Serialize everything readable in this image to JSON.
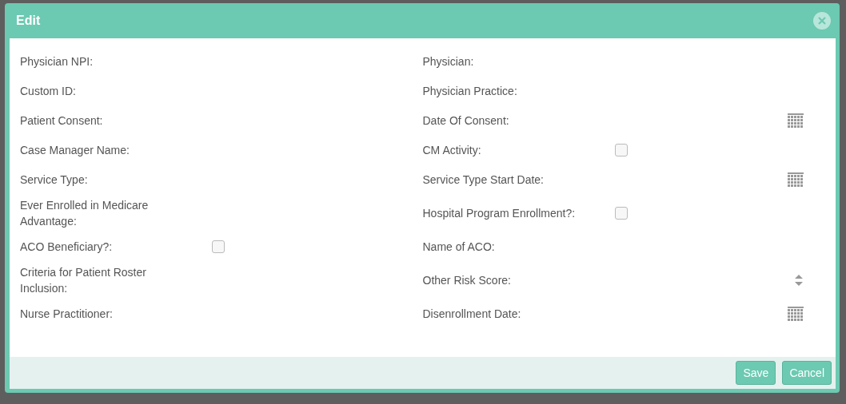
{
  "dialog": {
    "title": "Edit"
  },
  "rows": [
    {
      "left": {
        "label": "Physician NPI:",
        "kind": "text"
      },
      "right": {
        "label": "Physician:",
        "kind": "text"
      }
    },
    {
      "left": {
        "label": "Custom ID:",
        "kind": "text"
      },
      "right": {
        "label": "Physician Practice:",
        "kind": "text"
      }
    },
    {
      "left": {
        "label": "Patient Consent:",
        "kind": "text"
      },
      "right": {
        "label": "Date Of Consent:",
        "kind": "date"
      }
    },
    {
      "left": {
        "label": "Case Manager Name:",
        "kind": "text"
      },
      "right": {
        "label": "CM Activity:",
        "kind": "checkbox",
        "checked": false
      }
    },
    {
      "left": {
        "label": "Service Type:",
        "kind": "text"
      },
      "right": {
        "label": "Service Type Start Date:",
        "kind": "date"
      }
    },
    {
      "left": {
        "label": "Ever Enrolled in Medicare Advantage:",
        "kind": "text"
      },
      "right": {
        "label": "Hospital Program Enrollment?:",
        "kind": "checkbox",
        "checked": false
      }
    },
    {
      "left": {
        "label": "ACO Beneficiary?:",
        "kind": "checkbox",
        "checked": false
      },
      "right": {
        "label": "Name of ACO:",
        "kind": "text"
      }
    },
    {
      "left": {
        "label": "Criteria for Patient Roster Inclusion:",
        "kind": "text"
      },
      "right": {
        "label": "Other Risk Score:",
        "kind": "spinner"
      }
    },
    {
      "left": {
        "label": "Nurse Practitioner:",
        "kind": "text"
      },
      "right": {
        "label": "Disenrollment Date:",
        "kind": "date"
      }
    }
  ],
  "buttons": [
    {
      "label": "Save"
    },
    {
      "label": "Cancel"
    }
  ]
}
